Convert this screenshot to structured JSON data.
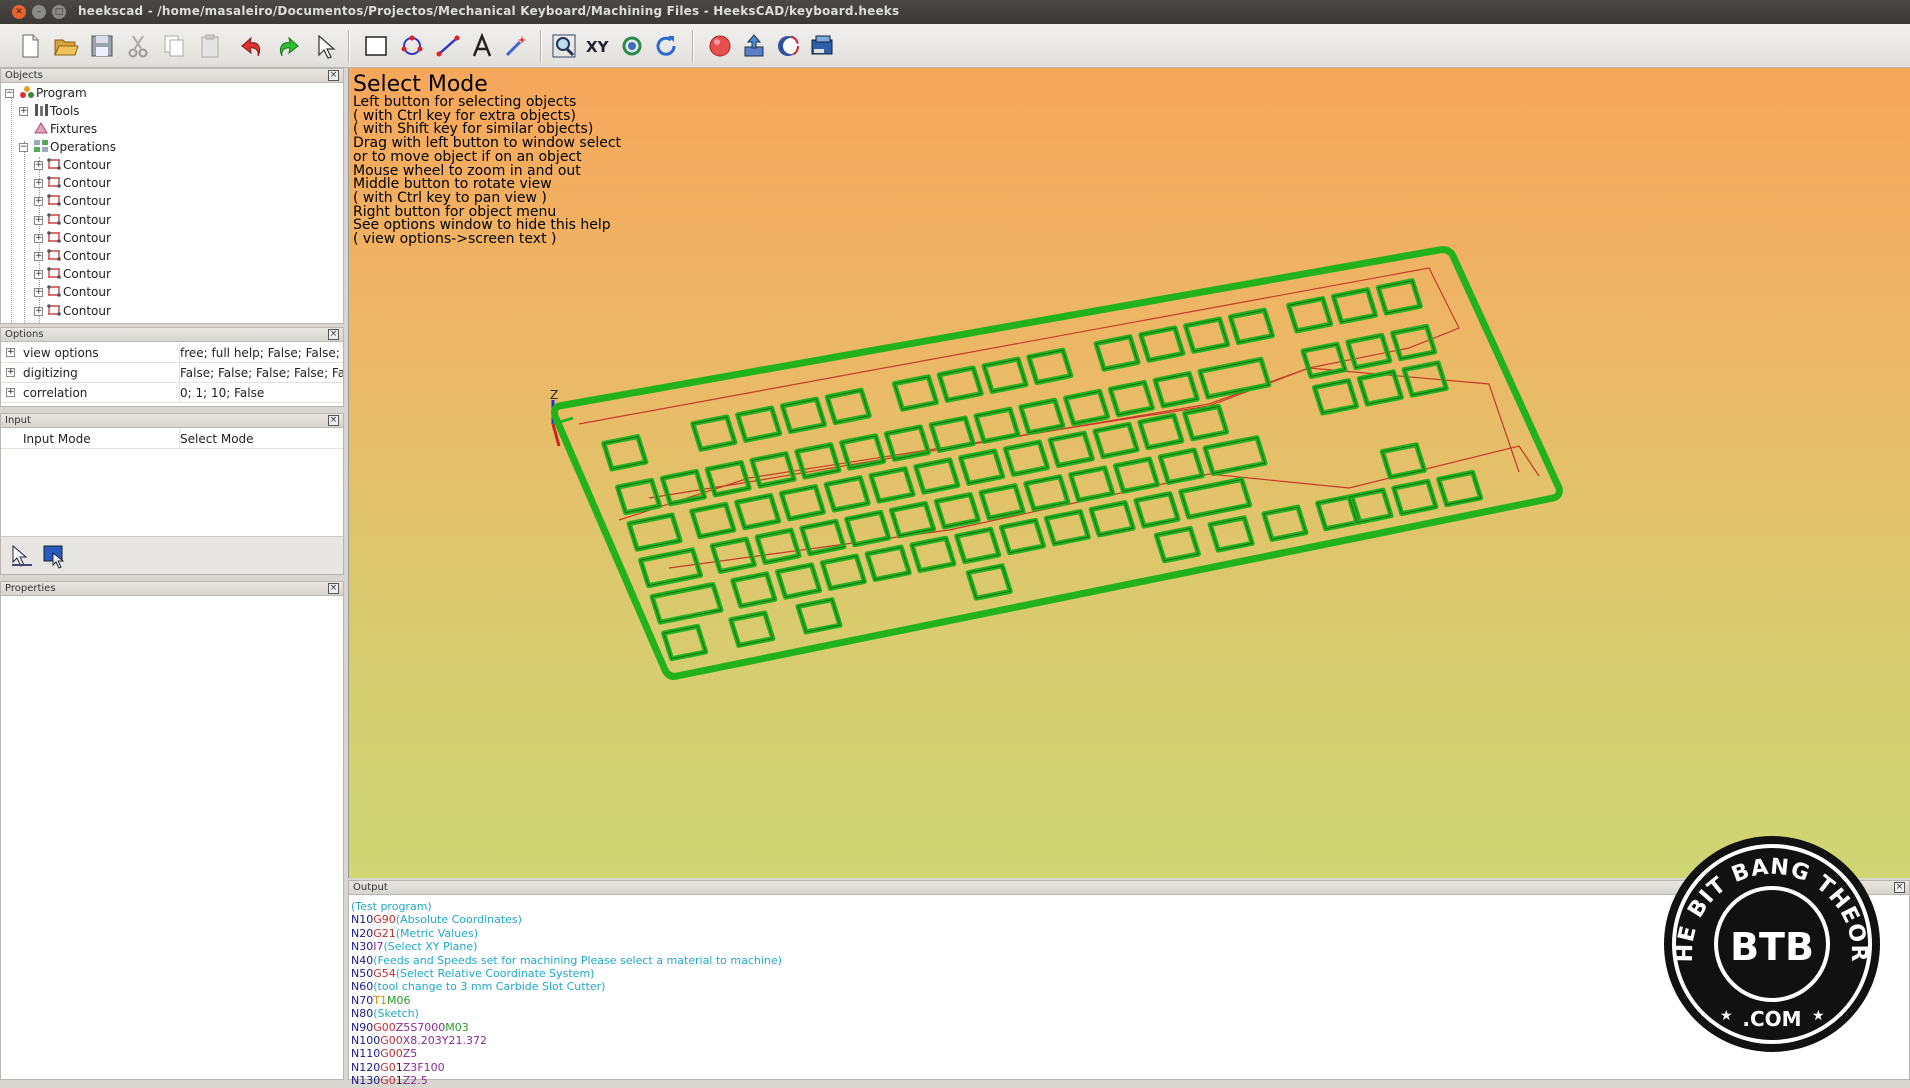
{
  "window": {
    "title": "heekscad - /home/masaleiro/Documentos/Projectos/Mechanical Keyboard/Machining Files - HeeksCAD/keyboard.heeks"
  },
  "panels": {
    "objects": {
      "title": "Objects",
      "tree": [
        {
          "label": "Program",
          "icon": "program-icon"
        },
        {
          "label": "Tools",
          "icon": "tools-icon"
        },
        {
          "label": "Fixtures",
          "icon": "fixtures-icon"
        },
        {
          "label": "Operations",
          "icon": "operations-icon"
        },
        {
          "label": "Contour"
        },
        {
          "label": "Contour"
        },
        {
          "label": "Contour"
        },
        {
          "label": "Contour"
        },
        {
          "label": "Contour"
        },
        {
          "label": "Contour"
        },
        {
          "label": "Contour"
        },
        {
          "label": "Contour"
        },
        {
          "label": "Contour"
        }
      ]
    },
    "options": {
      "title": "Options",
      "rows": [
        {
          "key": "view options",
          "value": "free; full help; False; False; Fa"
        },
        {
          "key": "digitizing",
          "value": "False; False; False; False; False;"
        },
        {
          "key": "correlation",
          "value": "0; 1; 10; False"
        }
      ]
    },
    "input": {
      "title": "Input",
      "rows": [
        {
          "key": "Input Mode",
          "value": "Select Mode"
        }
      ]
    },
    "properties": {
      "title": "Properties"
    },
    "output": {
      "title": "Output"
    }
  },
  "viewport": {
    "mode_title": "Select Mode",
    "help_lines": [
      "Left button for selecting objects",
      "( with Ctrl key for extra objects)",
      "( with Shift key for similar objects)",
      "Drag with left button to window select",
      "or to move object if on an object",
      "Mouse wheel to zoom in and out",
      "Middle button to rotate view",
      "( with Ctrl key to pan view )",
      "Right button for object menu",
      "See options window to hide this help",
      "( view options->screen text )"
    ],
    "axis_label": "Z"
  },
  "output": {
    "lines": [
      "(Test program)",
      "N10G90(Absolute Coordinates)",
      "N20G21(Metric Values)",
      "N30I7(Select XY Plane)",
      "N40(Feeds and Speeds set for machining Please select a material to machine)",
      "N50G54(Select Relative Coordinate System)",
      "N60(tool change to 3 mm Carbide Slot Cutter)",
      "N70T1M06",
      "N80(Sketch)",
      "N90G00Z5S7000M03",
      "N100G00X8.203Y21.372",
      "N110G00Z5",
      "N120G01Z3F100",
      "N130G01Z2.5"
    ]
  },
  "logo": {
    "ring_text": "THE BIT BANG THEORY",
    "monogram": "BTB",
    "domain": ".COM"
  },
  "colors": {
    "keyboard_green": "#22b21c",
    "toolpath_red": "#c83a28"
  }
}
